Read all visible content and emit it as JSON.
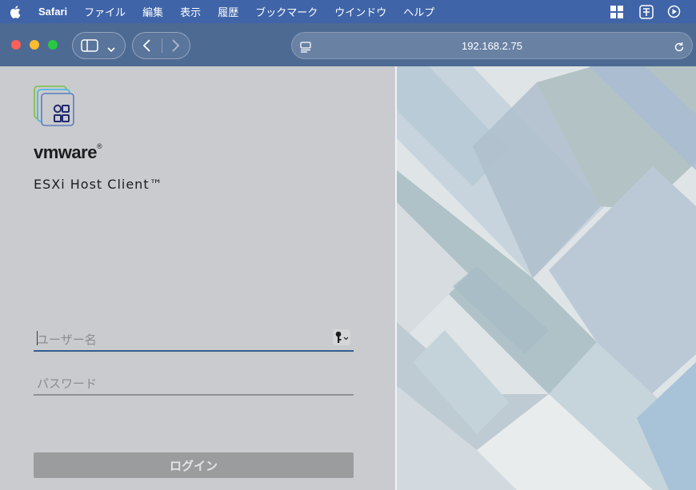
{
  "menubar": {
    "app_name": "Safari",
    "items": [
      "ファイル",
      "編集",
      "表示",
      "履歴",
      "ブックマーク",
      "ウインドウ",
      "ヘルプ"
    ],
    "status_icons": [
      "window-grid-icon",
      "text-input-icon",
      "media-play-icon"
    ]
  },
  "browser": {
    "url": "192.168.2.75",
    "icons": [
      "sidebar-icon",
      "chevron-down-icon",
      "back-icon",
      "forward-icon",
      "page-icon",
      "reload-icon"
    ]
  },
  "login": {
    "logo_icon": "vmware-apps-logo-icon",
    "brand": "vmware",
    "brand_mark": "®",
    "product": "ESXi Host Client™",
    "username_placeholder": "ユーザー名",
    "password_placeholder": "パスワード",
    "login_button": "ログイン",
    "key_icon": "password-key-icon"
  },
  "colors": {
    "menubar": "#3f64a8",
    "toolbar": "#4d6a93",
    "login_bg": "#c9cbce",
    "active_underline": "#345d8e",
    "button_disabled": "#9b9c9e"
  }
}
